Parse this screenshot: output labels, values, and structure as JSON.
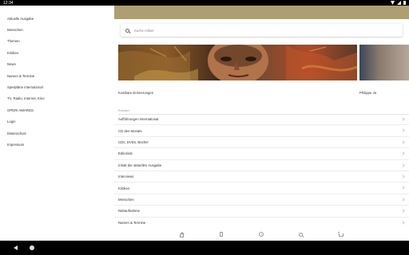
{
  "status_bar": {
    "time": "12:34"
  },
  "drawer": {
    "items": [
      "Aktuelle Ausgabe",
      "Menschen",
      "Themen",
      "Kritiken",
      "News",
      "Namen & Termine",
      "Spielpläne international",
      "TV, Radio, Internet, Kino",
      "OPER! AWARDS",
      "Login",
      "Datenschutz",
      "Impressum"
    ]
  },
  "header": {
    "color": "#ad9f73"
  },
  "search": {
    "placeholder": "Suche Artikel"
  },
  "featured": [
    {
      "caption": "Kostbare Erinnerungen"
    },
    {
      "caption": "Philippe Ja"
    }
  ],
  "categories": {
    "label": "Rubriken",
    "items": [
      "Aufführungen international",
      "CD des Monats",
      "CDs, DVDs, Bücher",
      "Editorials",
      "Inhalt der aktuellen Ausgabe",
      "Interviews",
      "Kritiken",
      "Menschen",
      "Nahaufnahme",
      "Namen & Termine"
    ]
  },
  "bottom_nav": [
    "home-icon",
    "issue-icon",
    "compass-icon",
    "search-icon",
    "cart-icon"
  ]
}
